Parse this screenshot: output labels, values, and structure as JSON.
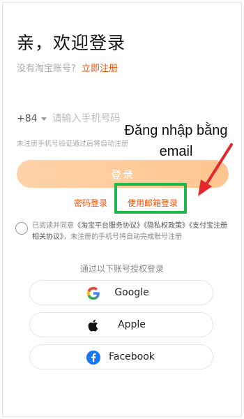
{
  "header": {
    "title": "亲，欢迎登录",
    "no_account": "没有淘宝账号?",
    "register_link": "立即注册"
  },
  "phone": {
    "country_code": "+84",
    "placeholder": "请输入手机号码",
    "hint": "未注册手机号验证通过后将自动注册"
  },
  "login_button": "登录",
  "alt_links": {
    "password_login": "密码登录",
    "email_login": "使用邮箱登录"
  },
  "annotation": {
    "line1": "Đăng nhập bằng",
    "line2": "email",
    "arrow_color": "#e5262b",
    "box_color": "#1fb84a"
  },
  "agreement": {
    "prefix": "已阅读并同意",
    "link1": "《淘宝平台服务协议》",
    "link2": "《隐私权政策》",
    "link3": "《支付宝注册相关协议》",
    "suffix": "，未注册的手机号将自动完成账号注册"
  },
  "auth": {
    "title": "通过以下账号授权登录",
    "providers": [
      {
        "label": "Google",
        "icon": "google-icon"
      },
      {
        "label": "Apple",
        "icon": "apple-icon"
      },
      {
        "label": "Facebook",
        "icon": "facebook-icon"
      }
    ]
  },
  "colors": {
    "accent": "#ff5000",
    "button_gradient_start": "#ffd2a8",
    "button_gradient_end": "#ffc58f"
  }
}
